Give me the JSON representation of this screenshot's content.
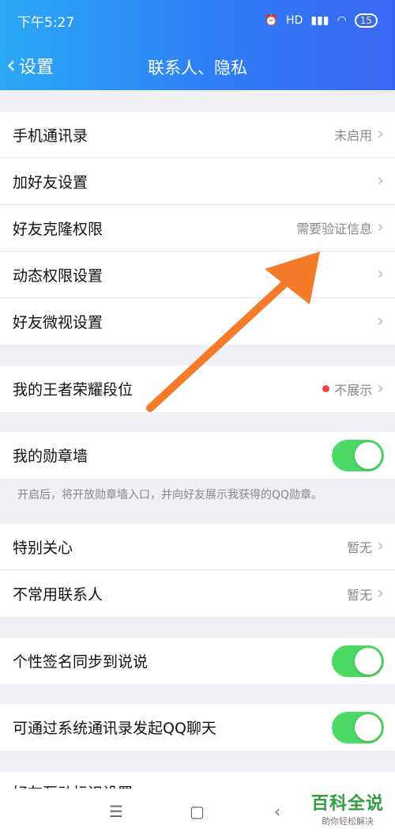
{
  "status": {
    "time": "下午5:27",
    "network": "HD",
    "battery": "15"
  },
  "nav": {
    "back_label": "设置",
    "title": "联系人、隐私"
  },
  "group1": [
    {
      "label": "手机通讯录",
      "value": "未启用"
    },
    {
      "label": "加好友设置",
      "value": ""
    },
    {
      "label": "好友克隆权限",
      "value": "需要验证信息"
    },
    {
      "label": "动态权限设置",
      "value": ""
    },
    {
      "label": "好友微视设置",
      "value": ""
    }
  ],
  "group2": {
    "label": "我的王者荣耀段位",
    "value": "不展示"
  },
  "group3": {
    "label": "我的勋章墙",
    "toggle": "on",
    "hint": "开启后，将开放勋章墙入口，并向好友展示我获得的QQ勋章。"
  },
  "group4": [
    {
      "label": "特别关心",
      "value": "暂无"
    },
    {
      "label": "不常用联系人",
      "value": "暂无"
    }
  ],
  "group5": {
    "label": "个性签名同步到说说",
    "toggle": "on"
  },
  "group6": {
    "label": "可通过系统通讯录发起QQ聊天",
    "toggle": "on"
  },
  "partial_row": {
    "label": "好友互动标识设置"
  },
  "watermark": {
    "big": "百科全说",
    "small": "助你轻松解决"
  },
  "colors": {
    "accent": "#2f7ef5",
    "toggle_on": "#4cd964",
    "arrow": "#f47b2a",
    "dot": "#f5463b"
  },
  "icons": [
    "back-chevron-icon",
    "chevron-right-icon",
    "menu-icon",
    "home-icon",
    "back-icon"
  ]
}
